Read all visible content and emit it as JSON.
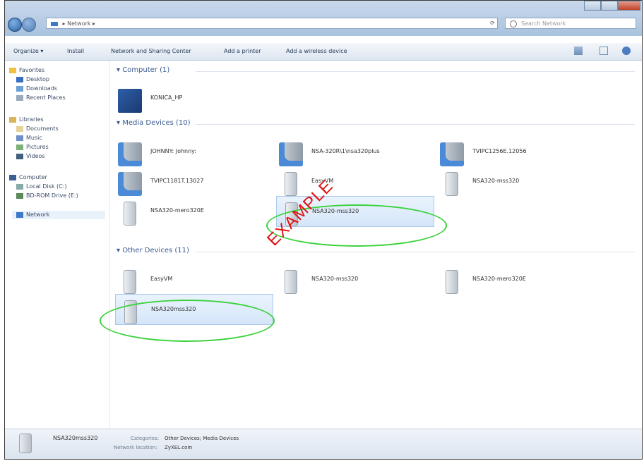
{
  "window": {
    "address_text": "▸ Network ▸",
    "search_placeholder": "Search Network"
  },
  "toolbar": {
    "organize": "Organize ▾",
    "install": "Install",
    "network_sharing_center": "Network and Sharing Center",
    "add_printer": "Add a printer",
    "add_wireless_device": "Add a wireless device"
  },
  "nav": {
    "favorites": "Favorites",
    "desktop": "Desktop",
    "downloads": "Downloads",
    "recent_places": "Recent Places",
    "libraries": "Libraries",
    "documents": "Documents",
    "music": "Music",
    "pictures": "Pictures",
    "videos": "Videos",
    "computer": "Computer",
    "local_disk": "Local Disk (C:)",
    "bd_rom": "BD-ROM Drive (E:)",
    "network": "Network"
  },
  "groups": {
    "computer": "▾ Computer (1)",
    "media": "▾ Media Devices (10)",
    "other": "▾ Other Devices (11)"
  },
  "computer_items": [
    {
      "label": "KONICA_HP",
      "icon": "computer-icon"
    }
  ],
  "media_items": [
    {
      "label": "JOHNNY: Johnny:",
      "icon": "media-server-icon"
    },
    {
      "label": "NSA-320R\\1\\nsa320plus",
      "icon": "media-server-icon"
    },
    {
      "label": "TVIPC1256E.12056",
      "icon": "media-server-icon"
    },
    {
      "label": "TVIPC1181T.13027",
      "icon": "media-server-icon"
    },
    {
      "label": "EasyVM",
      "icon": "device-icon"
    },
    {
      "label": "NSA320-mss320",
      "icon": "device-icon"
    },
    {
      "label": "NSA320-mero320E",
      "icon": "device-icon"
    },
    {
      "label": "NSA320-mss320",
      "icon": "device-icon"
    }
  ],
  "other_items": [
    {
      "label": "EasyVM",
      "icon": "device-icon"
    },
    {
      "label": "NSA320-mss320",
      "icon": "device-icon"
    },
    {
      "label": "NSA320-mero320E",
      "icon": "device-icon"
    },
    {
      "label": "NSA320mss320",
      "icon": "device-icon"
    }
  ],
  "details": {
    "name": "NSA320mss320",
    "categories_label": "Categories:",
    "categories_value": "Other Devices; Media Devices",
    "location_label": "Network location:",
    "location_value": "ZyXEL.com"
  },
  "watermark": "EXAMPLE",
  "colors": {
    "highlight_ellipse": "#3cd23c",
    "watermark": "#e01010",
    "group_header": "#3a5b92"
  }
}
